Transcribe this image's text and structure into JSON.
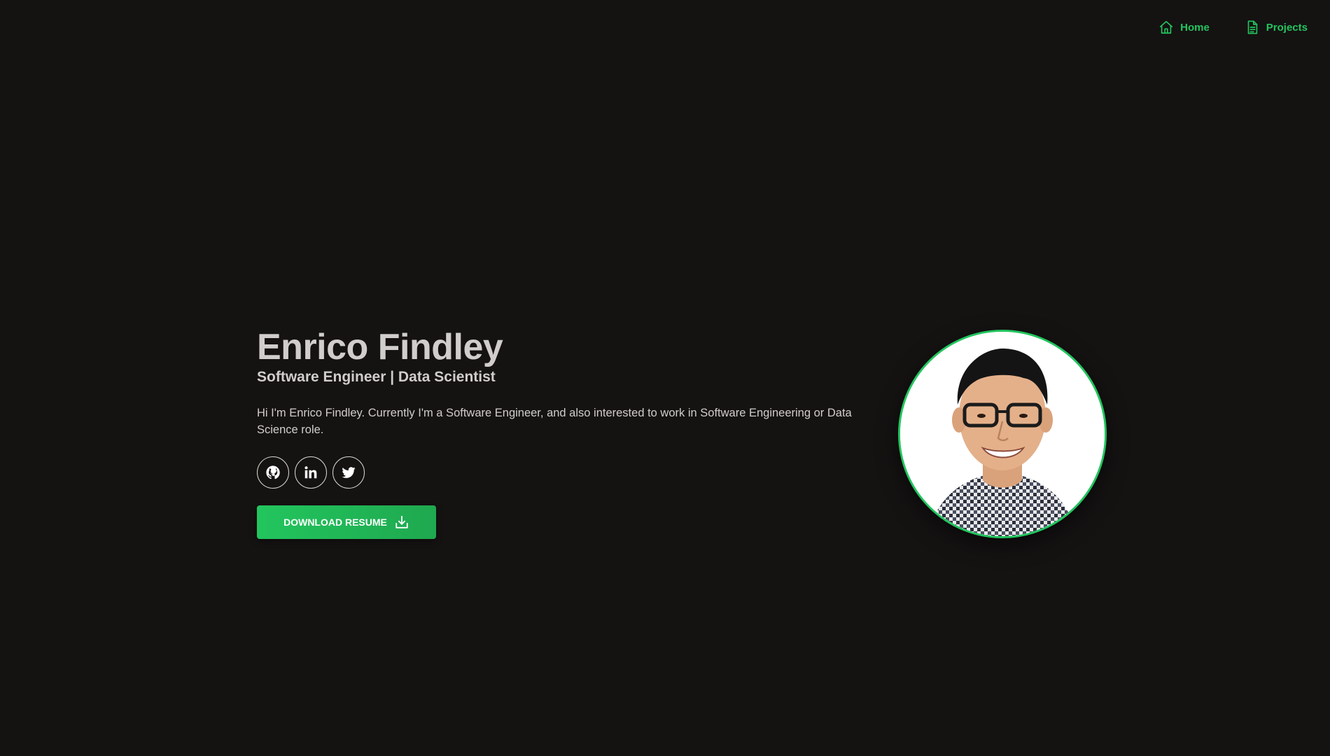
{
  "nav": {
    "items": [
      {
        "label": "Home",
        "icon": "home-icon"
      },
      {
        "label": "Projects",
        "icon": "document-icon"
      }
    ]
  },
  "hero": {
    "name": "Enrico Findley",
    "role": "Software Engineer | Data Scientist",
    "bio": "Hi I'm Enrico Findley. Currently I'm a Software Engineer, and also interested to work in Software Engineering or Data Science role.",
    "socials": [
      {
        "icon": "github-icon"
      },
      {
        "icon": "linkedin-icon"
      },
      {
        "icon": "twitter-icon"
      }
    ],
    "download_label": "DOWNLOAD RESUME",
    "download_icon": "download-icon"
  },
  "avatar": {
    "icon": "profile-photo"
  },
  "colors": {
    "background": "#151212",
    "accent": "#22c55e",
    "text": "#d1cdcd"
  }
}
